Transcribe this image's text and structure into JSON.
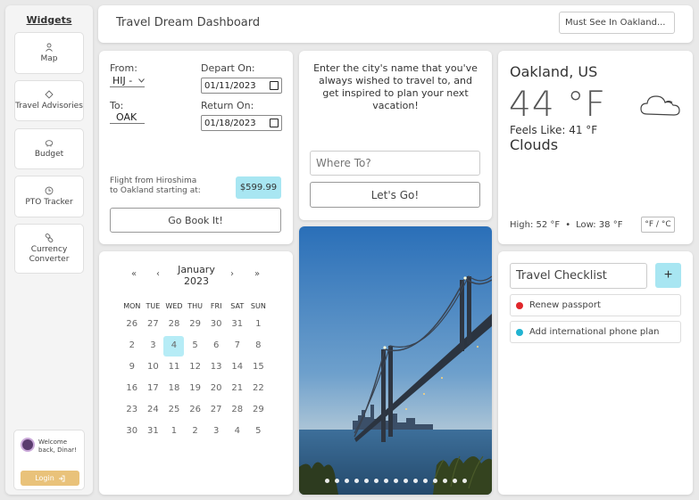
{
  "sidebar": {
    "title": "Widgets",
    "items": [
      {
        "label": "Map",
        "icon": "person-icon"
      },
      {
        "label": "Travel Advisories",
        "icon": "diamond-icon"
      },
      {
        "label": "Budget",
        "icon": "piggy-bank-icon"
      },
      {
        "label": "PTO Tracker",
        "icon": "clock-icon"
      },
      {
        "label": "Currency Converter",
        "icon": "link-icon"
      }
    ],
    "welcome": "Welcome back, Dinar!",
    "login_label": "Login"
  },
  "header": {
    "title": "Travel Dream Dashboard",
    "search_value": "Must See In Oakland..."
  },
  "flight": {
    "from_label": "From:",
    "from_value": "HIJ -",
    "to_label": "To:",
    "to_value": "OAK",
    "depart_label": "Depart On:",
    "depart_value": "01/11/2023",
    "return_label": "Return On:",
    "return_value": "01/18/2023",
    "note_line1": "Flight from Hiroshima",
    "note_line2": "to Oakland starting at:",
    "price": "$599.99",
    "book_label": "Go Book It!"
  },
  "prompt": {
    "text": "Enter the city's name that you've always wished to travel to, and get inspired to plan your next vacation!",
    "input_placeholder": "Where To?",
    "button_label": "Let's Go!"
  },
  "weather": {
    "city": "Oakland, US",
    "temp": "44 °F",
    "feels": "Feels Like: 41 °F",
    "condition": "Clouds",
    "high": "High: 52 °F",
    "separator": "•",
    "low": "Low: 38 °F",
    "unit_toggle": "°F / °C",
    "icon": "cloud-icon"
  },
  "calendar": {
    "prev_year": "«",
    "prev_month": "‹",
    "month": "January",
    "year": "2023",
    "next_month": "›",
    "next_year": "»",
    "weekdays": [
      "MON",
      "TUE",
      "WED",
      "THU",
      "FRI",
      "SAT",
      "SUN"
    ],
    "days": [
      "26",
      "27",
      "28",
      "29",
      "30",
      "31",
      "1",
      "2",
      "3",
      "4",
      "5",
      "6",
      "7",
      "8",
      "9",
      "10",
      "11",
      "12",
      "13",
      "14",
      "15",
      "16",
      "17",
      "18",
      "19",
      "20",
      "21",
      "22",
      "23",
      "24",
      "25",
      "26",
      "27",
      "28",
      "29",
      "30",
      "31",
      "1",
      "2",
      "3",
      "4",
      "5"
    ],
    "selected": "4"
  },
  "photo": {
    "dot_count": 15
  },
  "checklist": {
    "title": "Travel Checklist",
    "add_label": "+",
    "items": [
      {
        "label": "Renew passport",
        "color": "#e0272b"
      },
      {
        "label": "Add international phone plan",
        "color": "#21b3d1"
      }
    ]
  }
}
